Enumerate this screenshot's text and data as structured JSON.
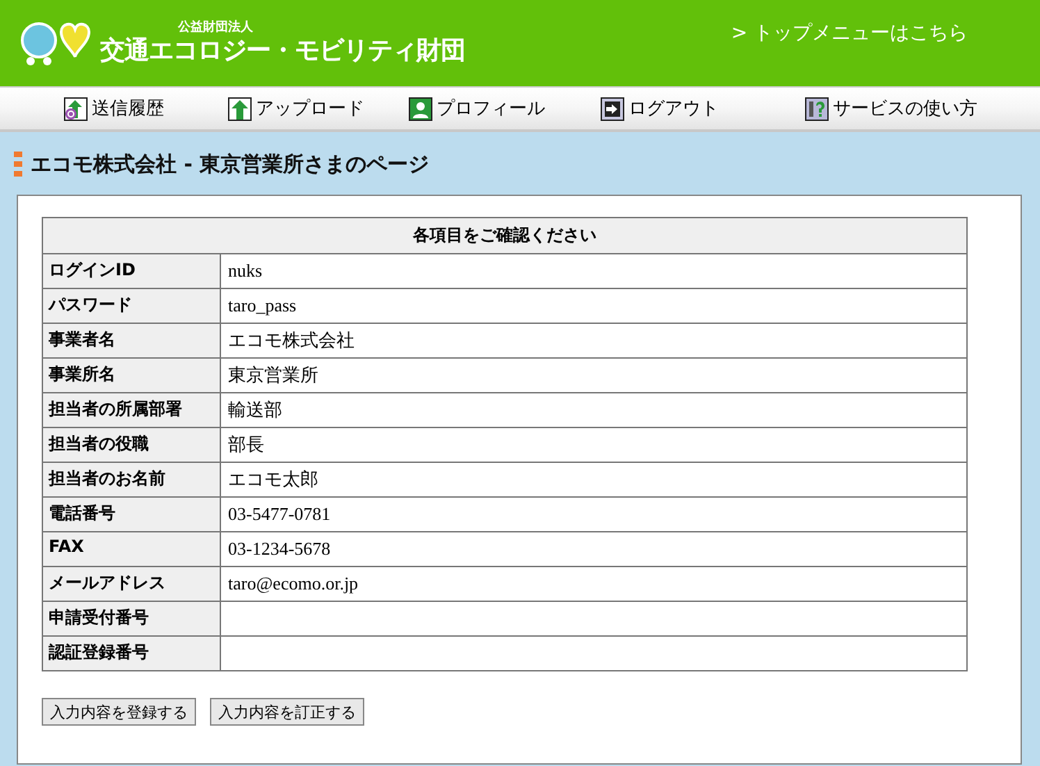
{
  "header": {
    "org_type": "公益財団法人",
    "org_name": "交通エコロジー・モビリティ財団",
    "top_link": "> トップメニューはこちら"
  },
  "nav": [
    {
      "label": "送信履歴",
      "kind": "history"
    },
    {
      "label": "アップロード",
      "kind": "upload"
    },
    {
      "label": "プロフィール",
      "kind": "profile"
    },
    {
      "label": "ログアウト",
      "kind": "logout"
    },
    {
      "label": "サービスの使い方",
      "kind": "help"
    }
  ],
  "page_title": "エコモ株式会社 - 東京営業所さまのページ",
  "table": {
    "caption": "各項目をご確認ください",
    "rows": [
      {
        "label": "ログインID",
        "value": "nuks"
      },
      {
        "label": "パスワード",
        "value": "taro_pass"
      },
      {
        "label": "事業者名",
        "value": "エコモ株式会社"
      },
      {
        "label": "事業所名",
        "value": "東京営業所"
      },
      {
        "label": "担当者の所属部署",
        "value": "輸送部"
      },
      {
        "label": "担当者の役職",
        "value": "部長"
      },
      {
        "label": "担当者のお名前",
        "value": "エコモ太郎"
      },
      {
        "label": "電話番号",
        "value": "03-5477-0781"
      },
      {
        "label": "FAX",
        "value": "03-1234-5678"
      },
      {
        "label": "メールアドレス",
        "value": "taro@ecomo.or.jp"
      },
      {
        "label": "申請受付番号"
      },
      {
        "label": "認証登録番号"
      }
    ]
  },
  "buttons": [
    "入力内容を登録する",
    "入力内容を訂正する"
  ]
}
